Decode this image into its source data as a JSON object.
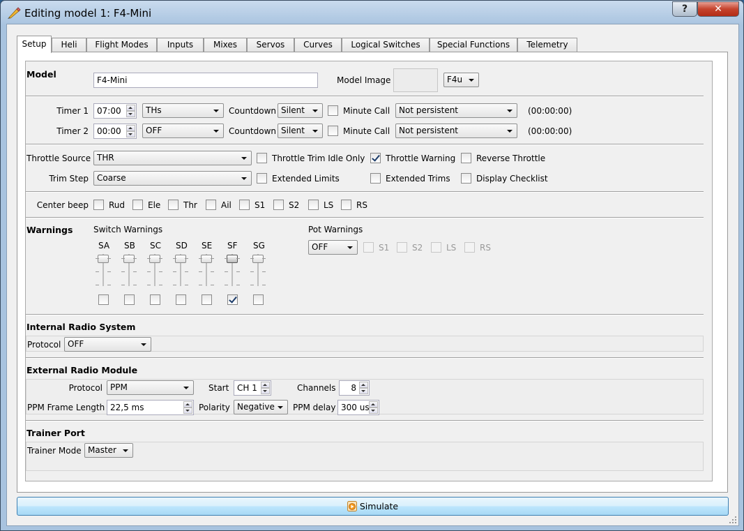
{
  "window": {
    "title": "Editing model 1: F4-Mini",
    "help_label": "?",
    "close_label": "✕"
  },
  "tabs": [
    {
      "label": "Setup"
    },
    {
      "label": "Heli"
    },
    {
      "label": "Flight Modes"
    },
    {
      "label": "Inputs"
    },
    {
      "label": "Mixes"
    },
    {
      "label": "Servos"
    },
    {
      "label": "Curves"
    },
    {
      "label": "Logical Switches"
    },
    {
      "label": "Special Functions"
    },
    {
      "label": "Telemetry"
    }
  ],
  "model": {
    "heading": "Model",
    "name_value": "F4-Mini",
    "image_label": "Model Image",
    "image_select": "F4u"
  },
  "timers": [
    {
      "label": "Timer 1",
      "time": "07:00",
      "source": "THs",
      "countdown_label": "Countdown",
      "countdown": "Silent",
      "minute_call_label": "Minute Call",
      "minute_call": false,
      "persistent": "Not persistent",
      "value": "(00:00:00)"
    },
    {
      "label": "Timer 2",
      "time": "00:00",
      "source": "OFF",
      "countdown_label": "Countdown",
      "countdown": "Silent",
      "minute_call_label": "Minute Call",
      "minute_call": false,
      "persistent": "Not persistent",
      "value": "(00:00:00)"
    }
  ],
  "throttle": {
    "source_label": "Throttle Source",
    "source": "THR",
    "trim_step_label": "Trim Step",
    "trim_step": "Coarse",
    "trim_idle_label": "Throttle Trim Idle Only",
    "warning_label": "Throttle Warning",
    "reverse_label": "Reverse Throttle",
    "ext_limits_label": "Extended Limits",
    "ext_trims_label": "Extended Trims",
    "checklist_label": "Display Checklist"
  },
  "center_beep": {
    "label": "Center beep",
    "items": [
      "Rud",
      "Ele",
      "Thr",
      "Ail",
      "S1",
      "S2",
      "LS",
      "RS"
    ]
  },
  "warnings": {
    "heading": "Warnings",
    "switch_label": "Switch Warnings",
    "switches": [
      {
        "name": "SA",
        "checked": false
      },
      {
        "name": "SB",
        "checked": false
      },
      {
        "name": "SC",
        "checked": false
      },
      {
        "name": "SD",
        "checked": false
      },
      {
        "name": "SE",
        "checked": false
      },
      {
        "name": "SF",
        "checked": true
      },
      {
        "name": "SG",
        "checked": false
      }
    ],
    "pot_label": "Pot Warnings",
    "pot_mode": "OFF",
    "pots": [
      "S1",
      "S2",
      "LS",
      "RS"
    ]
  },
  "internal": {
    "heading": "Internal Radio System",
    "protocol_label": "Protocol",
    "protocol": "OFF"
  },
  "external": {
    "heading": "External Radio Module",
    "protocol_label": "Protocol",
    "protocol": "PPM",
    "start_label": "Start",
    "start": "CH 1",
    "channels_label": "Channels",
    "channels": "8",
    "frame_label": "PPM Frame Length",
    "frame": "22,5 ms",
    "polarity_label": "Polarity",
    "polarity": "Negative",
    "delay_label": "PPM delay",
    "delay": "300 us"
  },
  "trainer": {
    "heading": "Trainer Port",
    "mode_label": "Trainer Mode",
    "mode": "Master"
  },
  "simulate_label": "Simulate"
}
